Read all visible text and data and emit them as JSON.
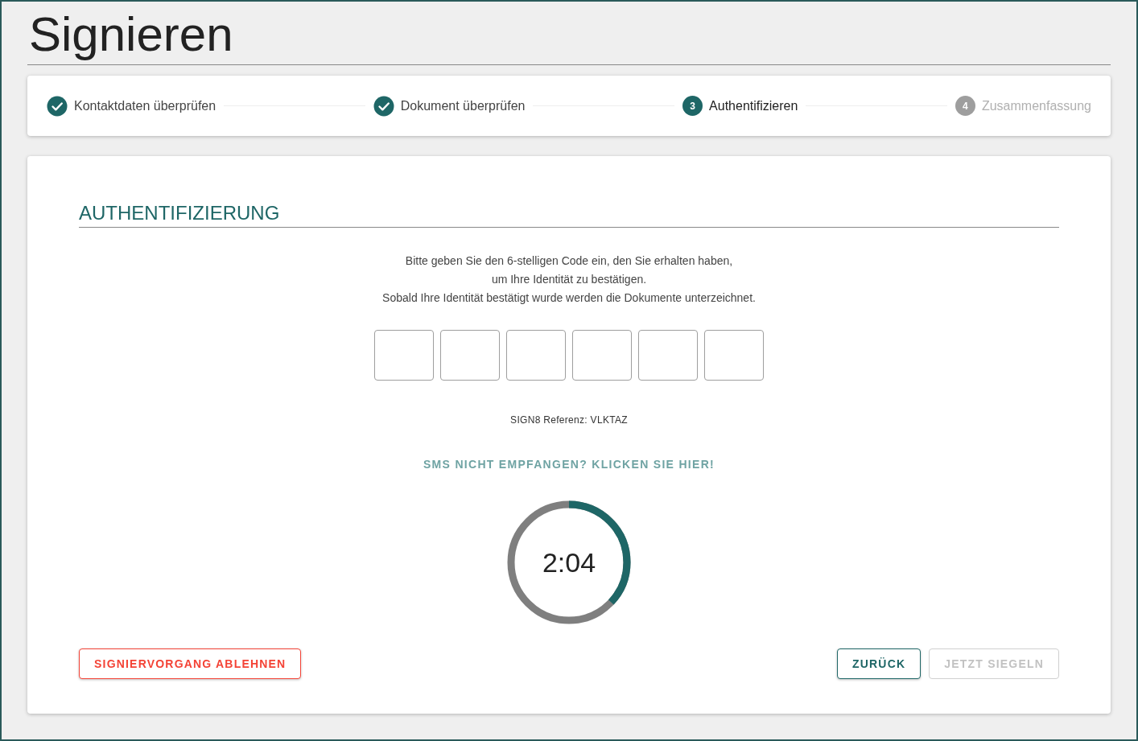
{
  "page": {
    "title": "Signieren"
  },
  "steps": [
    {
      "label": "Kontaktdaten überprüfen",
      "kind": "done"
    },
    {
      "label": "Dokument überprüfen",
      "kind": "done"
    },
    {
      "label": "Authentifizieren",
      "number": "3",
      "kind": "current"
    },
    {
      "label": "Zusammenfassung",
      "number": "4",
      "kind": "upcoming"
    }
  ],
  "auth": {
    "heading": "AUTHENTIFIZIERUNG",
    "instructions": [
      "Bitte geben Sie den 6-stelligen Code ein, den Sie erhalten haben,",
      "um Ihre Identität zu bestätigen.",
      "Sobald Ihre Identität bestätigt wurde werden die Dokumente unterzeichnet."
    ],
    "code_fields": [
      {
        "focused": false
      },
      {
        "focused": false
      },
      {
        "focused": false
      },
      {
        "focused": false
      },
      {
        "focused": false
      },
      {
        "focused": false
      }
    ],
    "reference": "SIGN8 Referenz: VLKTAZ",
    "resend_link": "SMS NICHT EMPFANGEN? KLICKEN SIE HIER!",
    "timer": {
      "reading": "2:04",
      "level": 0.37
    }
  },
  "buttons": [
    {
      "label": "SIGNIERVORGANG ABLEHNEN",
      "kind": "danger",
      "disabled": false
    },
    {
      "label": "ZURÜCK",
      "kind": "primary",
      "disabled": false
    },
    {
      "label": "JETZT SIEGELN",
      "kind": "primary",
      "disabled": true
    }
  ]
}
